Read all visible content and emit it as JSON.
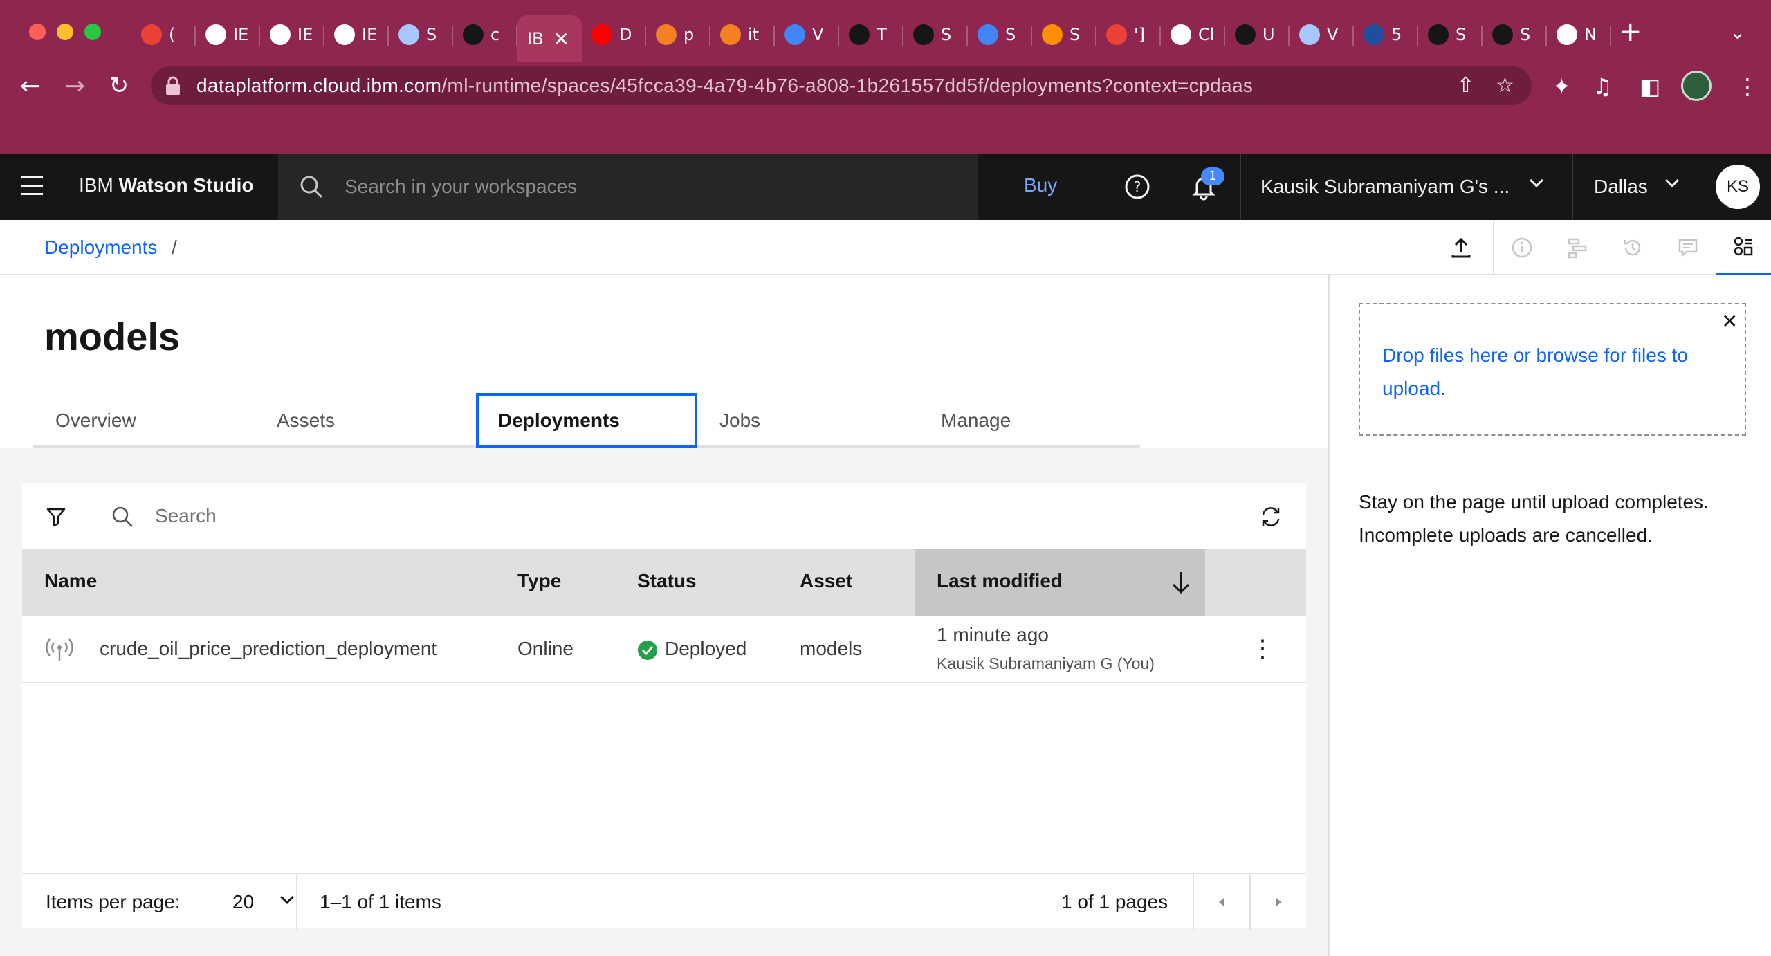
{
  "browser": {
    "tabs": [
      {
        "letter": "(",
        "icon": "gmail-icon",
        "color": "#ea4335"
      },
      {
        "letter": "IE",
        "icon": "globe-icon",
        "color": "#ffffff"
      },
      {
        "letter": "IE",
        "icon": "globe-icon",
        "color": "#ffffff"
      },
      {
        "letter": "IE",
        "icon": "github-icon",
        "color": "#ffffff"
      },
      {
        "letter": "S",
        "icon": "ibm-cloud-icon",
        "color": "#a6c8ff"
      },
      {
        "letter": "c",
        "icon": "ibm-bee-icon",
        "color": "#161616"
      },
      {
        "letter": "IB",
        "icon": "",
        "color": "#ffffff",
        "active": true
      },
      {
        "letter": "D",
        "icon": "youtube-icon",
        "color": "#ff0000"
      },
      {
        "letter": "p",
        "icon": "stackoverflow-icon",
        "color": "#f48024"
      },
      {
        "letter": "it",
        "icon": "stackoverflow-icon",
        "color": "#f48024"
      },
      {
        "letter": "V",
        "icon": "google-icon",
        "color": "#4285f4"
      },
      {
        "letter": "T",
        "icon": "ibm-bee-icon",
        "color": "#161616"
      },
      {
        "letter": "S",
        "icon": "bee-icon",
        "color": "#161616"
      },
      {
        "letter": "S",
        "icon": "google-icon",
        "color": "#4285f4"
      },
      {
        "letter": "S",
        "icon": "tensorflow-icon",
        "color": "#ff8f00"
      },
      {
        "letter": "']",
        "icon": "gmail-icon",
        "color": "#ea4335"
      },
      {
        "letter": "Cl",
        "icon": "speaker-icon",
        "color": "#ffffff"
      },
      {
        "letter": "U",
        "icon": "bee-icon",
        "color": "#161616"
      },
      {
        "letter": "V",
        "icon": "ibm-cloud-icon",
        "color": "#a6c8ff"
      },
      {
        "letter": "5",
        "icon": "tableau-icon",
        "color": "#1f4e9e"
      },
      {
        "letter": "S",
        "icon": "bee-icon",
        "color": "#161616"
      },
      {
        "letter": "S",
        "icon": "bee-icon",
        "color": "#161616"
      },
      {
        "letter": "N",
        "icon": "chrome-icon",
        "color": "#ffffff"
      }
    ],
    "url_host": "dataplatform.cloud.ibm.com",
    "url_path": "/ml-runtime/spaces/45fcca39-4a79-4b76-a808-1b261557dd5f/deployments?context=cpdaas"
  },
  "header": {
    "product_prefix": "IBM",
    "product_name": "Watson Studio",
    "search_placeholder": "Search in your workspaces",
    "buy_label": "Buy",
    "notification_count": "1",
    "account_name": "Kausik Subramaniyam G's ...",
    "region": "Dallas",
    "avatar_initials": "KS"
  },
  "breadcrumb": {
    "link": "Deployments",
    "separator": "/"
  },
  "page": {
    "title": "models",
    "tabs": [
      {
        "label": "Overview"
      },
      {
        "label": "Assets"
      },
      {
        "label": "Deployments"
      },
      {
        "label": "Jobs"
      },
      {
        "label": "Manage"
      }
    ]
  },
  "table": {
    "search_placeholder": "Search",
    "columns": [
      "Name",
      "Type",
      "Status",
      "Asset",
      "Last modified"
    ],
    "rows": [
      {
        "name": "crude_oil_price_prediction_deployment",
        "type": "Online",
        "status": "Deployed",
        "asset": "models",
        "modified": "1 minute ago",
        "modified_by": "Kausik Subramaniyam G (You)"
      }
    ],
    "pager": {
      "items_per_page_label": "Items per page:",
      "items_per_page_value": "20",
      "range": "1–1 of 1 items",
      "pages": "1 of 1 pages"
    }
  },
  "upload_panel": {
    "dropzone_text": "Drop files here or browse for files to upload.",
    "note": "Stay on the page until upload completes. Incomplete uploads are cancelled."
  },
  "colors": {
    "chrome": "#8e2650",
    "ibm_blue": "#0f62fe",
    "success": "#24a148"
  }
}
